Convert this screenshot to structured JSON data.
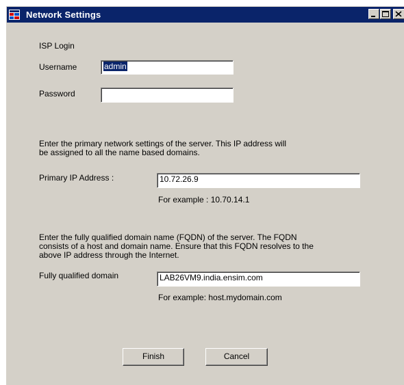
{
  "window": {
    "title": "Network Settings"
  },
  "isp": {
    "heading": "ISP Login",
    "username_label": "Username",
    "username_value": "admin",
    "password_label": "Password",
    "password_value": ""
  },
  "ip_section": {
    "description_line1": "Enter the primary network  settings of the server. This IP address will",
    "description_line2": "be assigned to all the name based domains.",
    "label": "Primary IP Address :",
    "value": "10.72.26.9",
    "example": "For example : 10.70.14.1"
  },
  "fqdn_section": {
    "description_line1": "Enter the fully qualified domain name (FQDN) of the server. The FQDN",
    "description_line2": "consists of a host and domain name. Ensure that this FQDN resolves to the",
    "description_line3": "above IP address through the Internet.",
    "label": "Fully qualified domain",
    "value": "LAB26VM9.india.ensim.com",
    "example": "For example: host.mydomain.com"
  },
  "buttons": {
    "finish": "Finish",
    "cancel": "Cancel"
  },
  "colors": {
    "titlebar": "#0a246a",
    "window_bg": "#d4d0c8"
  },
  "icons": [
    "app-icon",
    "minimize-icon",
    "maximize-icon",
    "close-icon"
  ]
}
